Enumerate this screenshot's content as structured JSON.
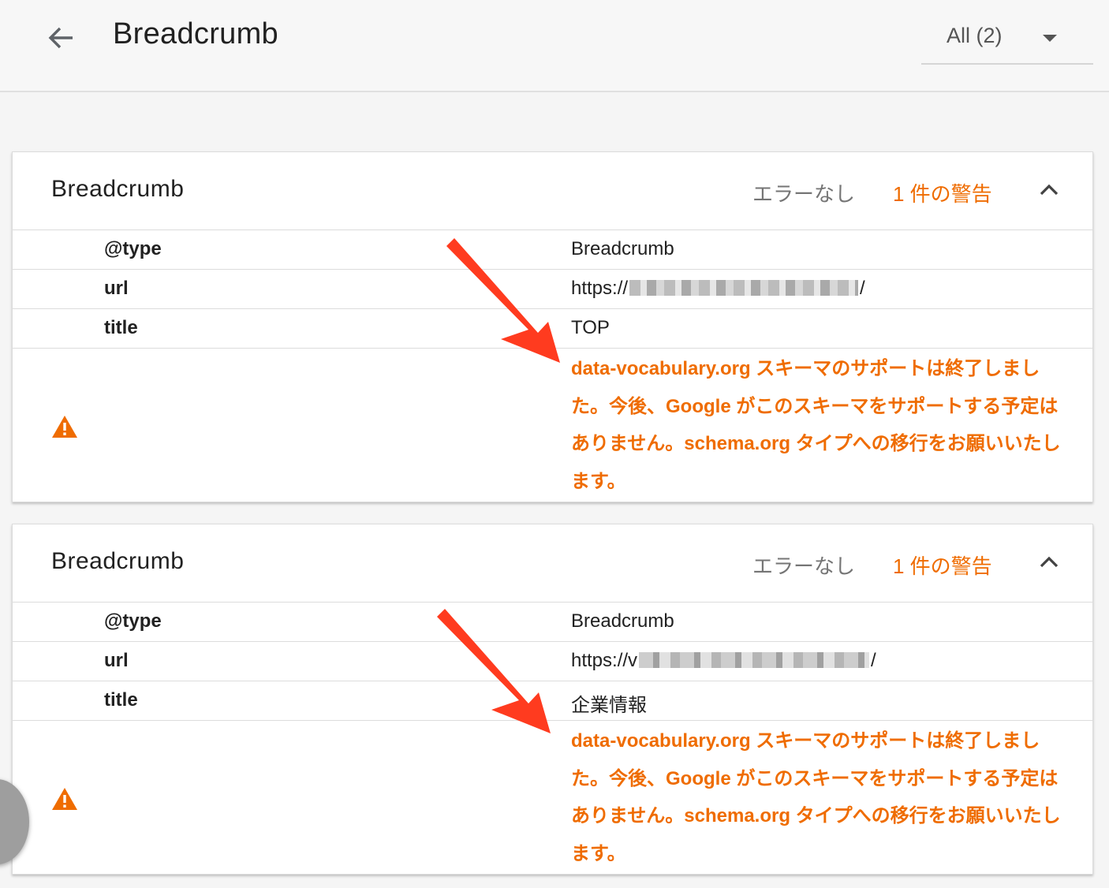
{
  "header": {
    "title": "Breadcrumb",
    "filter_label": "All (2)"
  },
  "colors": {
    "warning": "#ef6c00",
    "annotation_arrow": "#ff3b1f"
  },
  "cards": [
    {
      "title": "Breadcrumb",
      "status_errors": "エラーなし",
      "status_warnings": "1 件の警告",
      "properties": [
        {
          "key": "@type",
          "value": "Breadcrumb"
        },
        {
          "key": "url",
          "value_prefix": "https://",
          "value_suffix": "/",
          "value_obscured": true
        },
        {
          "key": "title",
          "value": "TOP"
        }
      ],
      "warning_icon": "warning-triangle-icon",
      "warning_text": "data-vocabulary.org スキーマのサポートは終了しました。今後、Google がこのスキーマをサポートする予定はありません。schema.org タイプへの移行をお願いいたします。"
    },
    {
      "title": "Breadcrumb",
      "status_errors": "エラーなし",
      "status_warnings": "1 件の警告",
      "properties": [
        {
          "key": "@type",
          "value": "Breadcrumb"
        },
        {
          "key": "url",
          "value_prefix": "https://v",
          "value_suffix": "/",
          "value_obscured": true
        },
        {
          "key": "title",
          "value": "企業情報"
        }
      ],
      "warning_icon": "warning-triangle-icon",
      "warning_text": "data-vocabulary.org スキーマのサポートは終了しました。今後、Google がこのスキーマをサポートする予定はありません。schema.org タイプへの移行をお願いいたします。"
    }
  ]
}
